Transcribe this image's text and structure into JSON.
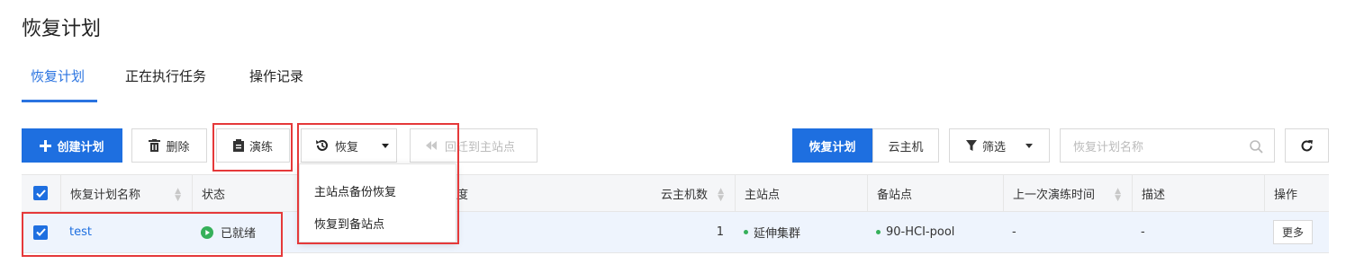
{
  "page_title": "恢复计划",
  "tabs": [
    {
      "label": "恢复计划",
      "active": true
    },
    {
      "label": "正在执行任务",
      "active": false
    },
    {
      "label": "操作记录",
      "active": false
    }
  ],
  "toolbar": {
    "create_label": "创建计划",
    "delete_label": "删除",
    "drill_label": "演练",
    "restore_label": "恢复",
    "failback_label": "回迁到主站点",
    "view_plan_label": "恢复计划",
    "view_vm_label": "云主机",
    "filter_label": "筛选",
    "search_placeholder": "恢复计划名称"
  },
  "restore_menu": {
    "items": [
      "主站点备份恢复",
      "恢复到备站点"
    ]
  },
  "table": {
    "headers": {
      "name": "恢复计划名称",
      "status": "状态",
      "progress_partial": "度",
      "vm_count": "云主机数",
      "primary_site": "主站点",
      "backup_site": "备站点",
      "last_drill": "上一次演练时间",
      "description": "描述",
      "actions": "操作"
    },
    "rows": [
      {
        "name": "test",
        "status": "已就绪",
        "vm_count": "1",
        "primary_site": "延伸集群",
        "backup_site": "90-HCI-pool",
        "last_drill": "-",
        "description": "-",
        "more_label": "更多"
      }
    ]
  },
  "colors": {
    "accent": "#1e6fe0",
    "status_ok": "#35b05a",
    "highlight": "#e5393a"
  }
}
